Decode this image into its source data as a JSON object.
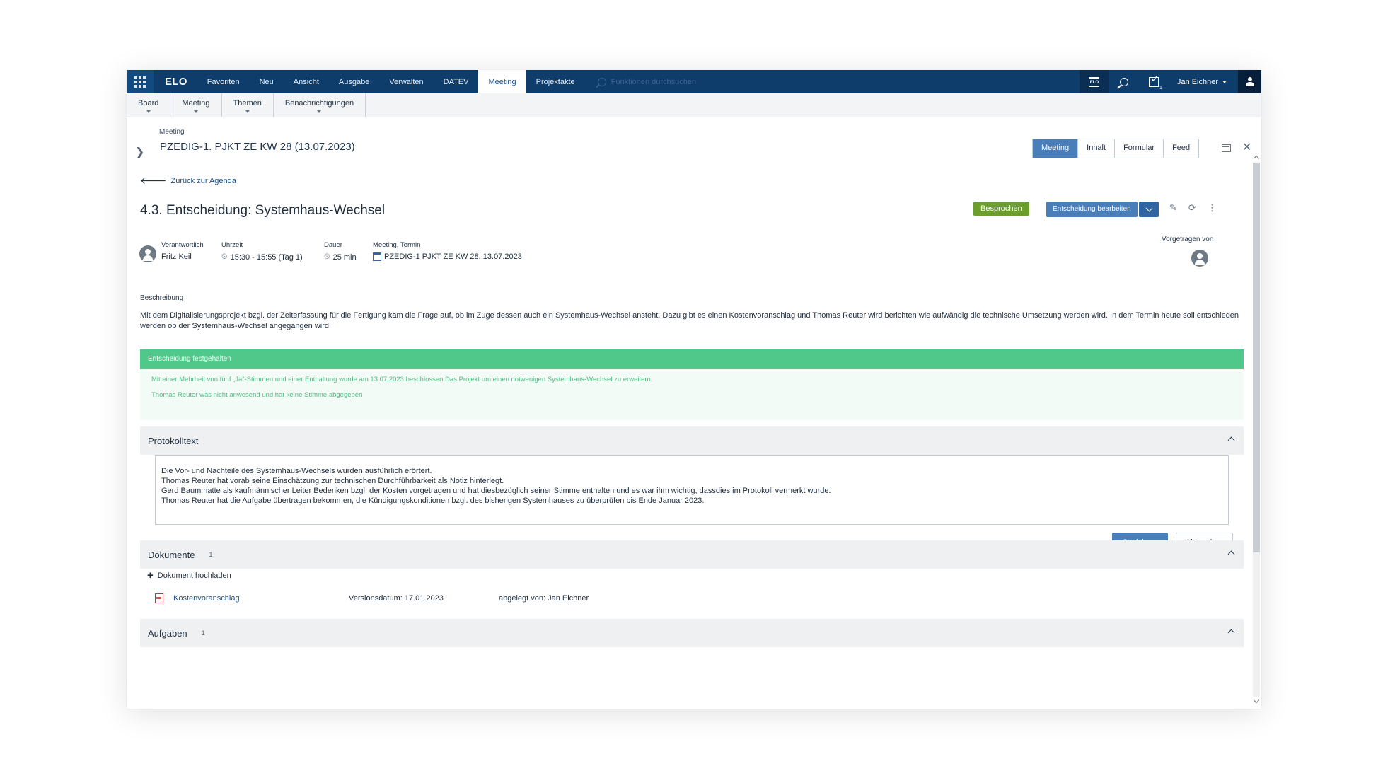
{
  "topnav": {
    "brand": "ELO",
    "menu": [
      "Favoriten",
      "Neu",
      "Ansicht",
      "Ausgabe",
      "Verwalten",
      "DATEV",
      "Meeting",
      "Projektakte"
    ],
    "active_index": 6,
    "search_placeholder": "Funktionen durchsuchen",
    "calendar_glyph": "ELO",
    "task_count": "1",
    "user": "Jan Eichner"
  },
  "subnav": {
    "items": [
      "Board",
      "Meeting",
      "Themen",
      "Benachrichtigungen"
    ]
  },
  "header": {
    "label": "Meeting",
    "title": "PZEDIG-1. PJKT ZE KW 28 (13.07.2023)",
    "view_tabs": [
      "Meeting",
      "Inhalt",
      "Formular",
      "Feed"
    ],
    "active_tab_index": 0
  },
  "item": {
    "back_label": "Zurück zur Agenda",
    "title": "4.3. Entscheidung: Systemhaus-Wechsel",
    "status": "Besprochen",
    "edit_label": "Entscheidung bearbeiten",
    "responsible_label": "Verantwortlich",
    "responsible": "Fritz Keil",
    "time_label": "Uhrzeit",
    "time": "15:30 - 15:55 (Tag 1)",
    "duration_label": "Dauer",
    "duration": "25 min",
    "meeting_label": "Meeting, Termin",
    "meeting": "PZEDIG-1 PJKT ZE KW 28, 13.07.2023",
    "presented_label": "Vorgetragen von",
    "desc_label": "Beschreibung",
    "description": "Mit dem Digitalisierungsprojekt bzgl. der Zeiterfassung für die Fertigung kam die Frage auf, ob im Zuge dessen auch ein Systemhaus-Wechsel ansteht. Dazu gibt es einen Kostenvoranschlag und Thomas Reuter wird berichten wie aufwändig die technische Umsetzung werden wird. In dem Termin heute soll entschieden werden ob der Systemhaus-Wechsel angegangen wird."
  },
  "decision": {
    "header": "Entscheidung festgehalten",
    "line1": "Mit einer Mehrheit von fünf „Ja“-Stimmen und einer Enthaltung wurde am 13.07.2023 beschlossen Das Projekt um einen notwenigen Systemhaus-Wechsel zu erweitern.",
    "line2": "Thomas Reuter was nicht anwesend und hat keine Stimme abgegeben"
  },
  "protocol": {
    "title": "Protokolltext",
    "lines": [
      "Die Vor- und Nachteile des Systemhaus-Wechsels wurden ausführlich erörtert.",
      "Thomas Reuter hat vorab seine Einschätzung zur technischen Durchführbarkeit als Notiz hinterlegt.",
      "Gerd Baum hatte als kaufmännischer Leiter Bedenken bzgl. der Kosten vorgetragen und hat diesbezüglich seiner Stimme enthalten und es war ihm wichtig, dassdies im Protokoll vermerkt wurde.",
      "Thomas Reuter hat die Aufgabe übertragen bekommen, die Kündigungskonditionen bzgl. des bisherigen Systemhauses zu überprüfen bis Ende Januar 2023."
    ],
    "save_label": "Speichern",
    "cancel_label": "Abbrechen"
  },
  "documents": {
    "title": "Dokumente",
    "count": "1",
    "upload_label": "Dokument hochladen",
    "rows": [
      {
        "name": "Kostenvoranschlag",
        "version": "Versionsdatum: 17.01.2023",
        "owner": "abgelegt von: Jan Eichner"
      }
    ]
  },
  "tasks": {
    "title": "Aufgaben",
    "count": "1"
  },
  "colors": {
    "nav": "#0f3d6b",
    "accent": "#4a7eb9",
    "status_green": "#6c9e2e",
    "decision_green": "#4fc88a"
  }
}
